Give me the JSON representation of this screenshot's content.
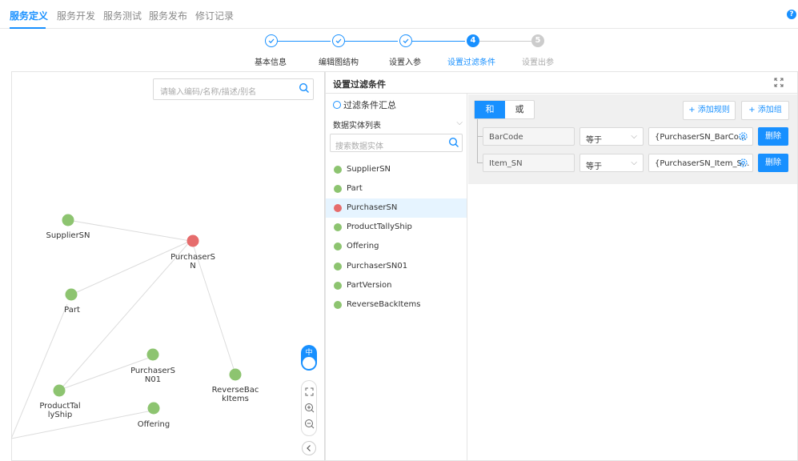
{
  "top_tabs": [
    "服务定义",
    "服务开发",
    "服务测试",
    "服务发布",
    "修订记录"
  ],
  "help_icon": "?",
  "steps": [
    {
      "label": "基本信息",
      "state": "done"
    },
    {
      "label": "编辑图结构",
      "state": "done"
    },
    {
      "label": "设置入参",
      "state": "done"
    },
    {
      "label": "设置过滤条件",
      "state": "active",
      "number": "4"
    },
    {
      "label": "设置出参",
      "state": "pending",
      "number": "5"
    }
  ],
  "graph": {
    "search_placeholder": "请输入编码/名称/描述/别名",
    "nodes": [
      {
        "label_lines": [
          "SupplierSN"
        ],
        "color": "#8dc470"
      },
      {
        "label_lines": [
          "PurchaserS",
          "N"
        ],
        "color": "#e66c6c"
      },
      {
        "label_lines": [
          "Part"
        ],
        "color": "#8dc470"
      },
      {
        "label_lines": [
          "PurchaserS",
          "N01"
        ],
        "color": "#8dc470"
      },
      {
        "label_lines": [
          "ReverseBac",
          "kItems"
        ],
        "color": "#8dc470"
      },
      {
        "label_lines": [
          "ProductTal",
          "lyShip"
        ],
        "color": "#8dc470"
      },
      {
        "label_lines": [
          "Offering"
        ],
        "color": "#8dc470"
      }
    ],
    "zoom_label": "中"
  },
  "filter_panel": {
    "title": "设置过滤条件",
    "summary_label": "过滤条件汇总",
    "entity_list_label": "数据实体列表",
    "entity_search_placeholder": "搜索数据实体",
    "entities": [
      {
        "name": "SupplierSN",
        "color": "#8dc470"
      },
      {
        "name": "Part",
        "color": "#8dc470"
      },
      {
        "name": "PurchaserSN",
        "color": "#e66c6c",
        "selected": true
      },
      {
        "name": "ProductTallyShip",
        "color": "#8dc470"
      },
      {
        "name": "Offering",
        "color": "#8dc470"
      },
      {
        "name": "PurchaserSN01",
        "color": "#8dc470"
      },
      {
        "name": "PartVersion",
        "color": "#8dc470"
      },
      {
        "name": "ReverseBackItems",
        "color": "#8dc470"
      }
    ],
    "logic_and": "和",
    "logic_or": "或",
    "add_rule": "+ 添加规则",
    "add_group": "+ 添加组",
    "rules": [
      {
        "field": "BarCode",
        "operator": "等于",
        "value": "{PurchaserSN_BarCo...",
        "delete": "删除"
      },
      {
        "field": "Item_SN",
        "operator": "等于",
        "value": "{PurchaserSN_Item_S...",
        "delete": "删除"
      }
    ]
  },
  "accent_color": "#1890ff"
}
